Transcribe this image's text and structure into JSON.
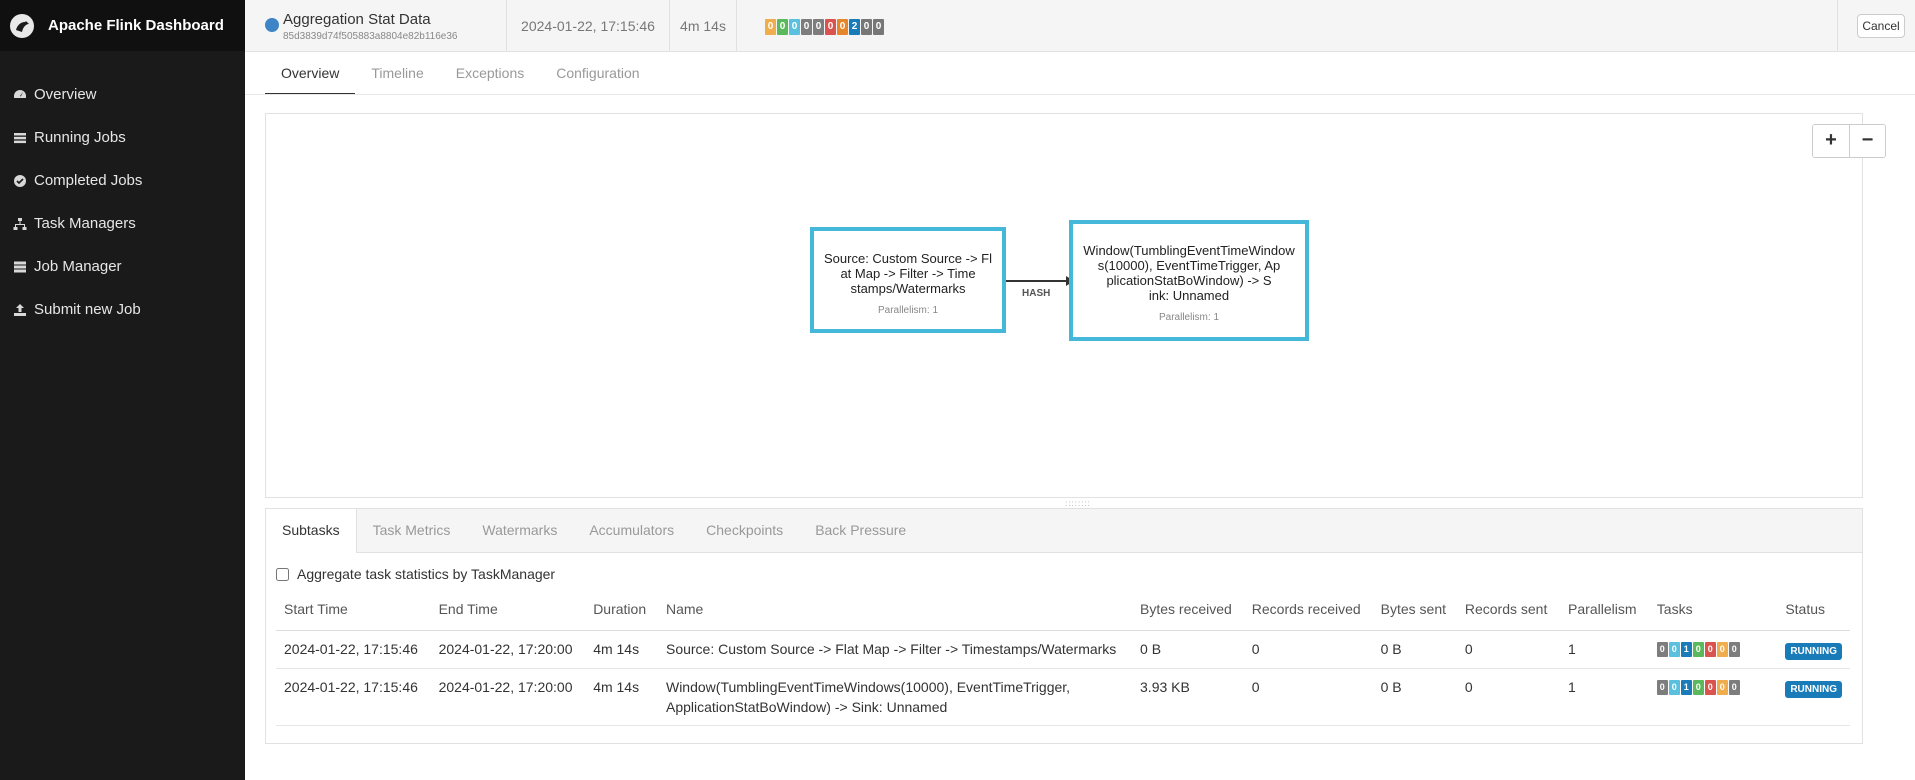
{
  "app": {
    "title": "Apache Flink Dashboard"
  },
  "sidebar": {
    "items": [
      {
        "label": "Overview",
        "icon": "dashboard-icon"
      },
      {
        "label": "Running Jobs",
        "icon": "tasks-icon"
      },
      {
        "label": "Completed Jobs",
        "icon": "check-circle-icon"
      },
      {
        "label": "Task Managers",
        "icon": "sitemap-icon"
      },
      {
        "label": "Job Manager",
        "icon": "server-icon"
      },
      {
        "label": "Submit new Job",
        "icon": "upload-icon"
      }
    ]
  },
  "job": {
    "name": "Aggregation Stat Data",
    "id": "85d3839d74f505883a8804e82b116e36",
    "start_time": "2024-01-22, 17:15:46",
    "duration": "4m 14s",
    "status_counts": [
      {
        "value": "0",
        "color": "#f0ad4e"
      },
      {
        "value": "0",
        "color": "#5cb85c"
      },
      {
        "value": "0",
        "color": "#5bc0de"
      },
      {
        "value": "0",
        "color": "#7d7d7d"
      },
      {
        "value": "0",
        "color": "#7d7d7d"
      },
      {
        "value": "0",
        "color": "#d9534f"
      },
      {
        "value": "0",
        "color": "#e6862c"
      },
      {
        "value": "2",
        "color": "#1a7bb9"
      },
      {
        "value": "0",
        "color": "#777777"
      },
      {
        "value": "0",
        "color": "#777777"
      }
    ],
    "cancel_label": "Cancel",
    "status_color": "#3d85c6"
  },
  "tabs": [
    "Overview",
    "Timeline",
    "Exceptions",
    "Configuration"
  ],
  "zoom": {
    "in": "+",
    "out": "−"
  },
  "graph": {
    "nodes": [
      {
        "lines": [
          "Source: Custom Source -> Fl",
          "at Map -> Filter -> Time",
          "stamps/Watermarks"
        ],
        "parallelism": "Parallelism: 1"
      },
      {
        "lines": [
          "Window(TumblingEventTimeWindow",
          "s(10000), EventTimeTrigger, Ap",
          "plicationStatBoWindow) -> S",
          "ink: Unnamed"
        ],
        "parallelism": "Parallelism: 1"
      }
    ],
    "edge_label": "HASH",
    "node_color": "#45b7d8"
  },
  "subtabs": [
    "Subtasks",
    "Task Metrics",
    "Watermarks",
    "Accumulators",
    "Checkpoints",
    "Back Pressure"
  ],
  "aggregate_label": "Aggregate task statistics by TaskManager",
  "table": {
    "headers": [
      "Start Time",
      "End Time",
      "Duration",
      "Name",
      "Bytes received",
      "Records received",
      "Bytes sent",
      "Records sent",
      "Parallelism",
      "Tasks",
      "Status"
    ],
    "rows": [
      {
        "start": "2024-01-22, 17:15:46",
        "end": "2024-01-22, 17:20:00",
        "duration": "4m 14s",
        "name": "Source: Custom Source -> Flat Map -> Filter -> Timestamps/Watermarks",
        "bytes_received": "0 B",
        "records_received": "0",
        "bytes_sent": "0 B",
        "records_sent": "0",
        "parallelism": "1",
        "tasks": [
          "0",
          "0",
          "1",
          "0",
          "0",
          "0",
          "0"
        ],
        "status": "RUNNING"
      },
      {
        "start": "2024-01-22, 17:15:46",
        "end": "2024-01-22, 17:20:00",
        "duration": "4m 14s",
        "name": "Window(TumblingEventTimeWindows(10000), EventTimeTrigger, ApplicationStatBoWindow) -> Sink: Unnamed",
        "bytes_received": "3.93 KB",
        "records_received": "0",
        "bytes_sent": "0 B",
        "records_sent": "0",
        "parallelism": "1",
        "tasks": [
          "0",
          "0",
          "1",
          "0",
          "0",
          "0",
          "0"
        ],
        "status": "RUNNING"
      }
    ],
    "task_colors": [
      "#7d7d7d",
      "#5bc0de",
      "#1a7bb9",
      "#5cb85c",
      "#d9534f",
      "#f0ad4e",
      "#7d7d7d"
    ],
    "status_color": "#1a7bb9"
  }
}
